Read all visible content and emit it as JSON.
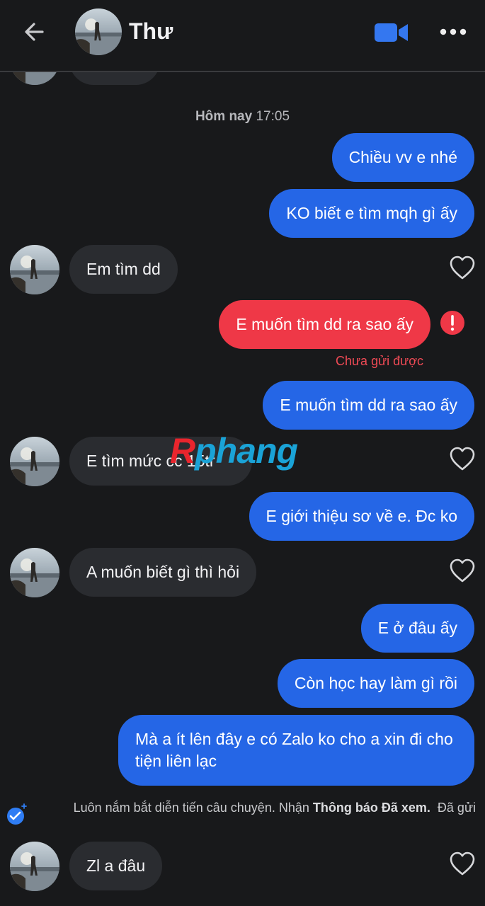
{
  "header": {
    "contact_name": "Thư"
  },
  "timestamp": {
    "day": "Hôm nay",
    "time": "17:05"
  },
  "messages": [
    {
      "text": "Chiều vv e nhé",
      "direction": "out"
    },
    {
      "text": "KO biết e tìm mqh gì ấy",
      "direction": "out"
    },
    {
      "text": "Em tìm dd",
      "direction": "in"
    },
    {
      "text": "E muốn tìm dd ra sao ấy",
      "direction": "out",
      "status": "failed"
    },
    {
      "text": "E muốn tìm dd ra sao ấy",
      "direction": "out"
    },
    {
      "text": "E tìm mức cc 15tr",
      "direction": "in"
    },
    {
      "text": "E giới thiệu sơ về e. Đc ko",
      "direction": "out"
    },
    {
      "text": "A muốn biết gì thì hỏi",
      "direction": "in"
    },
    {
      "text": "E ở đâu ấy",
      "direction": "out"
    },
    {
      "text": "Còn học hay làm gì rồi",
      "direction": "out"
    },
    {
      "text": "Mà a ít lên đây e có Zalo ko cho a xin đi cho tiện liên lạc",
      "direction": "out"
    },
    {
      "text": "Zl a đâu",
      "direction": "in"
    }
  ],
  "failed_label": "Chưa gửi được",
  "watermark": {
    "part1": "R",
    "part2": "phang"
  },
  "notice": {
    "text": "Luôn nắm bắt diễn tiến câu chuyện. Nhận ",
    "bold": "Thông báo Đã xem.",
    "status": "Đã gửi"
  },
  "colors": {
    "background": "#18191b",
    "outgoing_bubble": "#2566e6",
    "incoming_bubble": "#2a2c30",
    "failed_bubble": "#ef3847",
    "error_red": "#ef4a55"
  },
  "icons": [
    "back-arrow-icon",
    "video-call-icon",
    "more-icon",
    "heart-icon",
    "error-icon",
    "seen-check-icon"
  ]
}
